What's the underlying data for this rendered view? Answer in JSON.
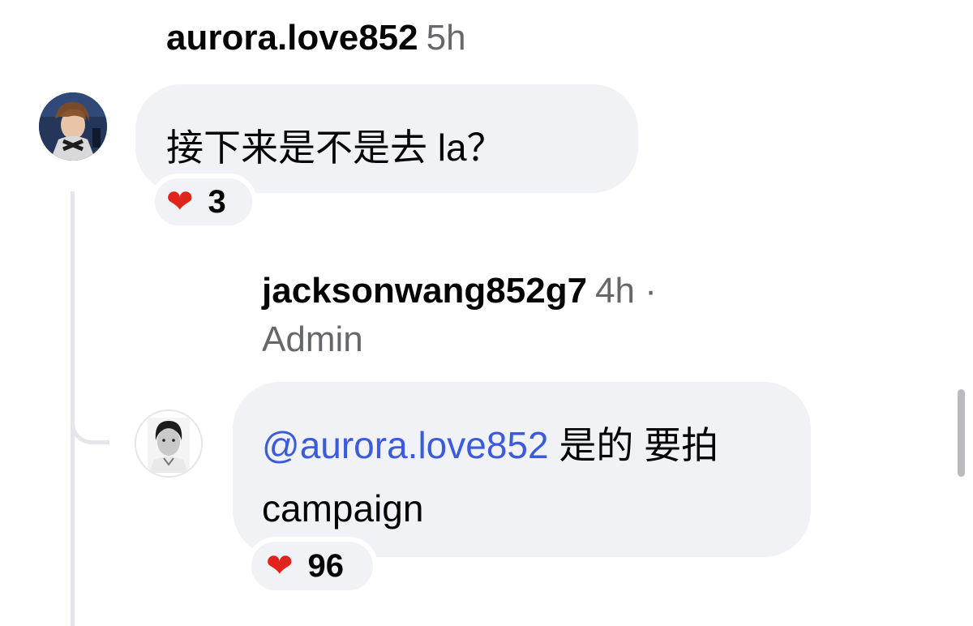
{
  "comments": [
    {
      "username": "aurora.love852",
      "time": "5h",
      "text": "接下来是不是去 la？",
      "reaction_count": "3",
      "reaction_icon": "heart-icon"
    },
    {
      "username": "jacksonwang852g7",
      "time": "4h ·",
      "role": "Admin",
      "mention": "@aurora.love852",
      "text_after_mention": " 是的 要拍 campaign",
      "reaction_count": "96",
      "reaction_icon": "heart-icon"
    }
  ],
  "colors": {
    "bubble": "#f0f2f5",
    "mention": "#3b5bdb",
    "muted": "#65676b",
    "heart": "#e0241b"
  }
}
